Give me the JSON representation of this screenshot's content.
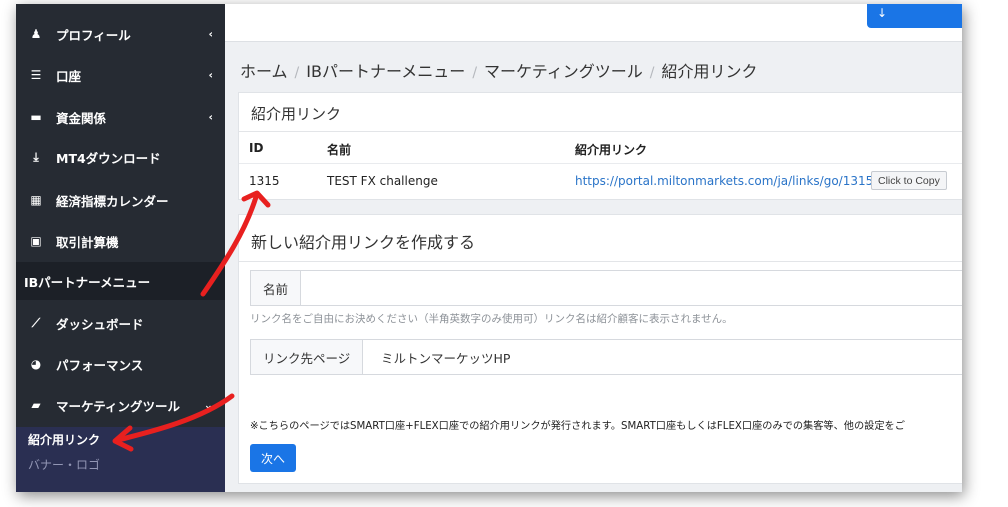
{
  "sidebar": {
    "items": [
      {
        "label": "プロフィール",
        "icon": "person-icon",
        "glyph": "♟",
        "chevron": "‹"
      },
      {
        "label": "口座",
        "icon": "list-icon",
        "glyph": "☰",
        "chevron": "‹"
      },
      {
        "label": "資金関係",
        "icon": "wallet-icon",
        "glyph": "▬",
        "chevron": "‹"
      },
      {
        "label": "MT4ダウンロード",
        "icon": "download-icon",
        "glyph": "⤓",
        "chevron": ""
      },
      {
        "label": "経済指標カレンダー",
        "icon": "calendar-icon",
        "glyph": "▦",
        "chevron": ""
      },
      {
        "label": "取引計算機",
        "icon": "calculator-icon",
        "glyph": "▣",
        "chevron": ""
      },
      {
        "label": "IBパートナーメニュー",
        "icon": "",
        "glyph": "",
        "chevron": ""
      },
      {
        "label": "ダッシュボード",
        "icon": "chart-icon",
        "glyph": "⟋",
        "chevron": ""
      },
      {
        "label": "パフォーマンス",
        "icon": "pie-chart-icon",
        "glyph": "◕",
        "chevron": ""
      },
      {
        "label": "マーケティングツール",
        "icon": "briefcase-icon",
        "glyph": "▰",
        "chevron": "⌄"
      }
    ],
    "sub_items": [
      {
        "label": "紹介用リンク"
      },
      {
        "label": "バナー・ロゴ"
      }
    ]
  },
  "breadcrumb": {
    "items": [
      "ホーム",
      "IBパートナーメニュー",
      "マーケティングツール",
      "紹介用リンク"
    ],
    "separator": "/"
  },
  "links_card": {
    "title": "紹介用リンク",
    "columns": [
      "ID",
      "名前",
      "紹介用リンク"
    ],
    "rows": [
      {
        "id": "1315",
        "name": "TEST FX challenge",
        "url": "https://portal.miltonmarkets.com/ja/links/go/1315"
      }
    ],
    "copy_label": "Click to Copy"
  },
  "create_card": {
    "title": "新しい紹介用リンクを作成する",
    "name_label": "名前",
    "name_value": "",
    "hint": "リンク名をご自由にお決めください（半角英数字のみ使用可）リンク名は紹介顧客に表示されません。",
    "page_label": "リンク先ページ",
    "page_value": "ミルトンマーケッツHP",
    "note": "※こちらのページではSMART口座+FLEX口座での紹介用リンクが発行されます。SMART口座もしくはFLEX口座のみでの集客等、他の設定をご",
    "submit_label": "次へ"
  },
  "colors": {
    "sidebar_bg": "#262b33",
    "sub_menu_bg": "#2a2f52",
    "accent": "#1a75e6",
    "link": "#2a74c8",
    "annotation_arrow": "#e8201f"
  }
}
